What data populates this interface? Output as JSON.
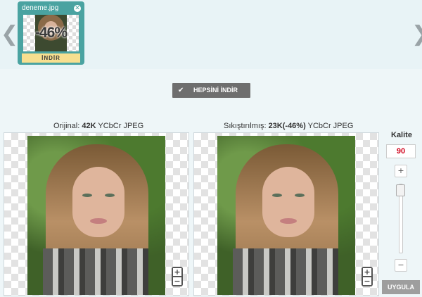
{
  "carousel": {
    "prev_icon": "chevron-left-icon",
    "next_icon": "chevron-right-icon",
    "prev_glyph": "❮",
    "next_glyph": "❯"
  },
  "file_card": {
    "name": "deneme.jpg",
    "close_glyph": "✕",
    "percent": "-46%",
    "download_label": "İNDİR",
    "accent": "#4aa3a1",
    "button_color": "#f7df8f"
  },
  "download_all": {
    "check_glyph": "✔",
    "label": "HEPSİNİ İNDİR"
  },
  "original": {
    "prefix": "Orijinal: ",
    "size": "42K",
    "format": " YCbCr JPEG"
  },
  "compressed": {
    "prefix": "Sıkıştırılmış: ",
    "size": "23K(-46%)",
    "format": " YCbCr JPEG"
  },
  "zoom": {
    "plus": "+",
    "minus": "−"
  },
  "quality": {
    "label": "Kalite",
    "value": "90",
    "plus": "+",
    "minus": "−",
    "slider_value": 90,
    "apply_label": "UYGULA"
  }
}
